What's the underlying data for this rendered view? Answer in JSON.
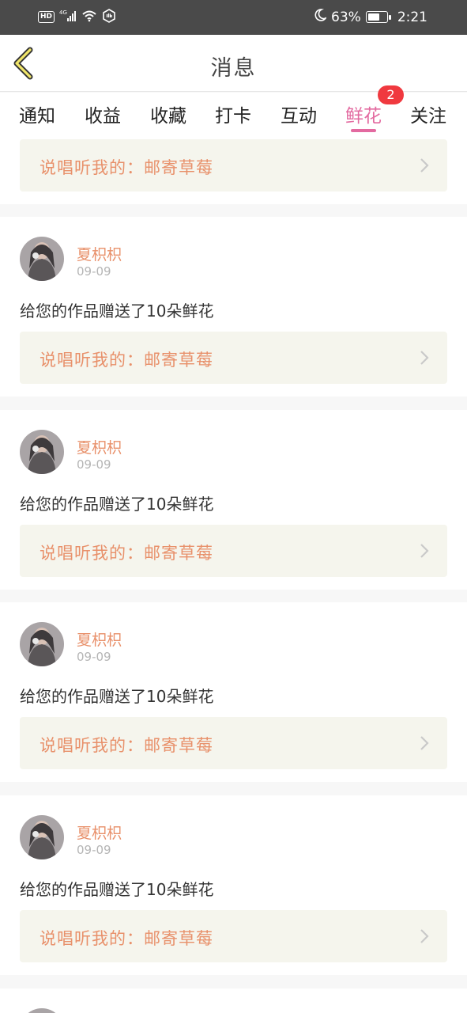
{
  "status_bar": {
    "hd": "HD",
    "network": "4G",
    "battery_pct_label": "63%",
    "battery_level": 0.63,
    "time": "2:21",
    "icons": [
      "hd-icon",
      "signal-icon",
      "wifi-icon",
      "hand-icon",
      "moon-icon",
      "battery-icon"
    ]
  },
  "header": {
    "title": "消息",
    "back_icon": "chevron-left-icon"
  },
  "tabs": {
    "items": [
      {
        "label": "通知"
      },
      {
        "label": "收益"
      },
      {
        "label": "收藏"
      },
      {
        "label": "打卡"
      },
      {
        "label": "互动"
      },
      {
        "label": "鲜花"
      },
      {
        "label": "关注"
      }
    ],
    "active": "鲜花",
    "badge_count": "2"
  },
  "colors": {
    "accent": "#e36aa0",
    "name": "#e8906a",
    "badge": "#f0393f",
    "link_bg": "#f5f5ed"
  },
  "top_partial": {
    "work_link": "说唱听我的：邮寄草莓"
  },
  "cards": [
    {
      "username": "夏枳枳",
      "date": "09-09",
      "message": "给您的作品赠送了10朵鲜花",
      "work_link": "说唱听我的：邮寄草莓"
    },
    {
      "username": "夏枳枳",
      "date": "09-09",
      "message": "给您的作品赠送了10朵鲜花",
      "work_link": "说唱听我的：邮寄草莓"
    },
    {
      "username": "夏枳枳",
      "date": "09-09",
      "message": "给您的作品赠送了10朵鲜花",
      "work_link": "说唱听我的：邮寄草莓"
    },
    {
      "username": "夏枳枳",
      "date": "09-09",
      "message": "给您的作品赠送了10朵鲜花",
      "work_link": "说唱听我的：邮寄草莓"
    }
  ]
}
